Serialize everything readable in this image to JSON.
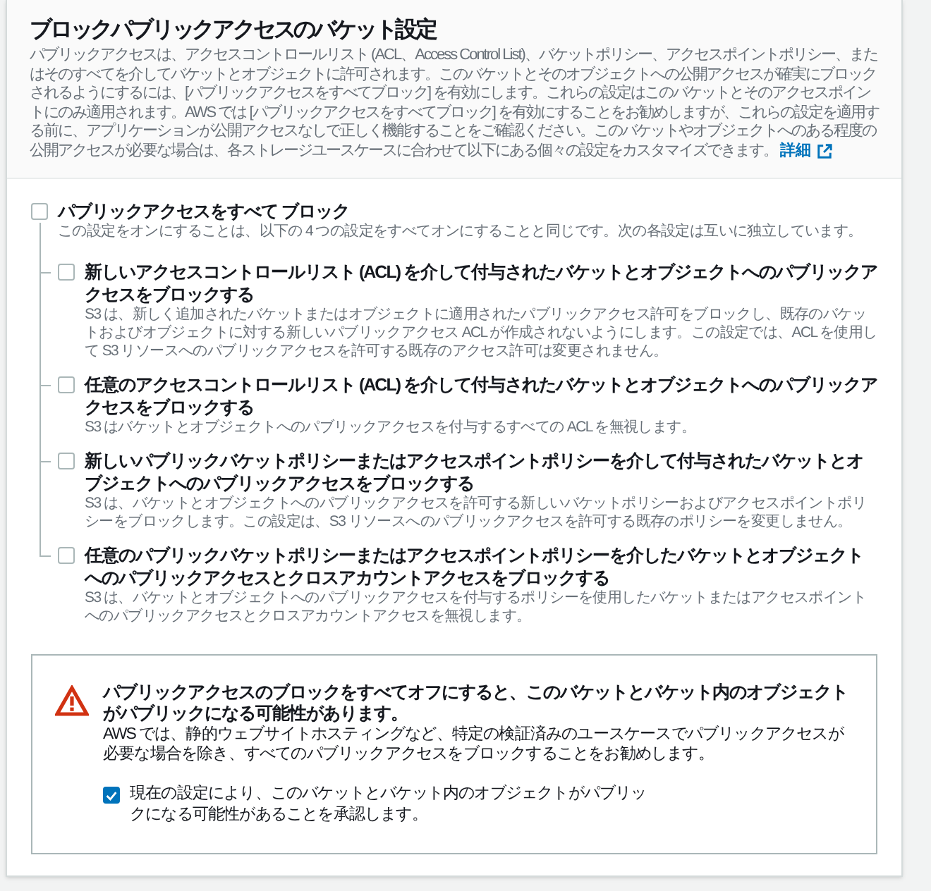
{
  "section": {
    "title": "ブロックパブリックアクセスのバケット設定",
    "description": "パブリックアクセスは、アクセスコントロールリスト (ACL、Access Control List)、バケットポリシー、アクセスポイントポリシー、またはそのすべてを介してバケットとオブジェクトに許可されます。このバケットとそのオブジェクトへの公開アクセスが確実にブロックされるようにするには、[パブリックアクセスをすべてブロック] を有効にします。これらの設定はこのバケットとそのアクセスポイントにのみ適用されます。AWS では [パブリックアクセスをすべてブロック] を有効にすることをお勧めしますが、これらの設定を適用する前に、アプリケーションが公開アクセスなしで正しく機能することをご確認ください。このバケットやオブジェクトへのある程度の公開アクセスが必要な場合は、各ストレージユースケースに合わせて以下にある個々の設定をカスタマイズできます。",
    "link": "詳細"
  },
  "block_all": {
    "label": "パブリックアクセスをすべて ブロック",
    "description": "この設定をオンにすることは、以下の 4 つの設定をすべてオンにすることと同じです。次の各設定は互いに独立しています。",
    "checked": false
  },
  "options": [
    {
      "label": "新しいアクセスコントロールリスト (ACL) を介して付与されたバケットとオブジェクトへのパブリックアクセスをブロックする",
      "description": "S3 は、新しく追加されたバケットまたはオブジェクトに適用されたパブリックアクセス許可をブロックし、既存のバケットおよびオブジェクトに対する新しいパブリックアクセス ACL が作成されないようにします。この設定では、ACL を使用して S3 リソースへのパブリックアクセスを許可する既存のアクセス許可は変更されません。",
      "checked": false
    },
    {
      "label": "任意のアクセスコントロールリスト (ACL) を介して付与されたバケットとオブジェクトへのパブリックアクセスをブロックする",
      "description": "S3 はバケットとオブジェクトへのパブリックアクセスを付与するすべての ACL を無視します。",
      "checked": false
    },
    {
      "label": "新しいパブリックバケットポリシーまたはアクセスポイントポリシーを介して付与されたバケットとオブジェクトへのパブリックアクセスをブロックする",
      "description": "S3 は、バケットとオブジェクトへのパブリックアクセスを許可する新しいバケットポリシーおよびアクセスポイントポリシーをブロックします。この設定は、S3 リソースへのパブリックアクセスを許可する既存のポリシーを変更しません。",
      "checked": false
    },
    {
      "label": "任意のパブリックバケットポリシーまたはアクセスポイントポリシーを介したバケットとオブジェクトへのパブリックアクセスとクロスアカウントアクセスをブロックする",
      "description": "S3 は、バケットとオブジェクトへのパブリックアクセスを付与するポリシーを使用したバケットまたはアクセスポイントへのパブリックアクセスとクロスアカウントアクセスを無視します。",
      "checked": false
    }
  ],
  "warning": {
    "title": "パブリックアクセスのブロックをすべてオフにすると、このバケットとバケット内のオブジェクトがパブリックになる可能性があります。",
    "message": "AWS では、静的ウェブサイトホスティングなど、特定の検証済みのユースケースでパブリックアクセスが必要な場合を除き、すべてのパブリックアクセスをブロックすることをお勧めします。",
    "acknowledge": {
      "label": "現在の設定により、このバケットとバケット内のオブジェクトがパブリックになる可能性があることを承認します。",
      "checked": true
    }
  }
}
